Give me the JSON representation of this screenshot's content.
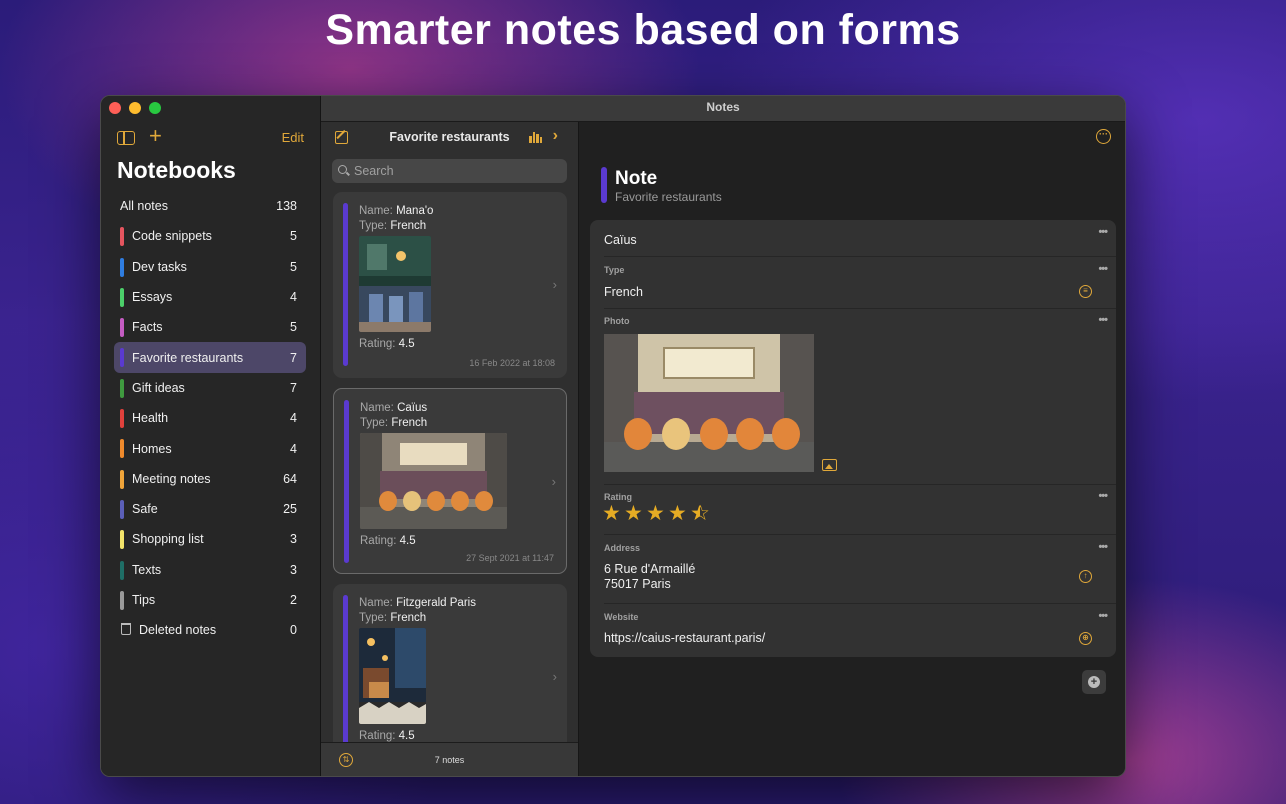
{
  "headline": "Smarter notes based on forms",
  "window": {
    "title": "Notes"
  },
  "sidebar": {
    "edit_label": "Edit",
    "title": "Notebooks",
    "all_notes": {
      "label": "All notes",
      "count": "138"
    },
    "items": [
      {
        "label": "Code snippets",
        "count": "5",
        "color": "#e5555f"
      },
      {
        "label": "Dev tasks",
        "count": "5",
        "color": "#2f7de0"
      },
      {
        "label": "Essays",
        "count": "4",
        "color": "#4ccf6a"
      },
      {
        "label": "Facts",
        "count": "5",
        "color": "#c45cc2"
      },
      {
        "label": "Favorite restaurants",
        "count": "7",
        "color": "#5a3ad0",
        "selected": true
      },
      {
        "label": "Gift ideas",
        "count": "7",
        "color": "#3f9a3f"
      },
      {
        "label": "Health",
        "count": "4",
        "color": "#e0413c"
      },
      {
        "label": "Homes",
        "count": "4",
        "color": "#ef8a2c"
      },
      {
        "label": "Meeting notes",
        "count": "64",
        "color": "#f0a53a"
      },
      {
        "label": "Safe",
        "count": "25",
        "color": "#5b5fb8"
      },
      {
        "label": "Shopping list",
        "count": "3",
        "color": "#f3e46a"
      },
      {
        "label": "Texts",
        "count": "3",
        "color": "#1f6e66"
      },
      {
        "label": "Tips",
        "count": "2",
        "color": "#9a9a9a"
      }
    ],
    "deleted": {
      "label": "Deleted notes",
      "count": "0"
    }
  },
  "notelist": {
    "title": "Favorite restaurants",
    "search_placeholder": "Search",
    "footer_count": "7 notes",
    "cards": [
      {
        "name_label": "Name:",
        "name": "Mana'o",
        "type_label": "Type:",
        "type": "French",
        "rating_label": "Rating:",
        "rating": "4.5",
        "date": "16 Feb 2022 at 18:08"
      },
      {
        "name_label": "Name:",
        "name": "Caïus",
        "type_label": "Type:",
        "type": "French",
        "rating_label": "Rating:",
        "rating": "4.5",
        "date": "27 Sept 2021 at 11:47"
      },
      {
        "name_label": "Name:",
        "name": "Fitzgerald Paris",
        "type_label": "Type:",
        "type": "French",
        "rating_label": "Rating:",
        "rating": "4.5",
        "date": ""
      }
    ]
  },
  "detail": {
    "title": "Note",
    "subtitle": "Favorite restaurants",
    "name_value": "Caïus",
    "type_label": "Type",
    "type_value": "French",
    "photo_label": "Photo",
    "rating_label": "Rating",
    "rating_value": 4.5,
    "address_label": "Address",
    "address_line1": "6 Rue d'Armaillé",
    "address_line2": "75017 Paris",
    "website_label": "Website",
    "website_value": "https://caius-restaurant.paris/"
  },
  "colors": {
    "accent": "#e0a83a",
    "notebook": "#5a3ad0"
  },
  "icons": [
    "sidebar-toggle-icon",
    "plus-icon",
    "compose-icon",
    "chart-icon",
    "chevron-right-icon",
    "search-icon",
    "more-icon",
    "list-icon",
    "photo-icon",
    "star-icon",
    "location-icon",
    "globe-icon",
    "sort-icon",
    "trash-icon",
    "add-field-icon"
  ]
}
